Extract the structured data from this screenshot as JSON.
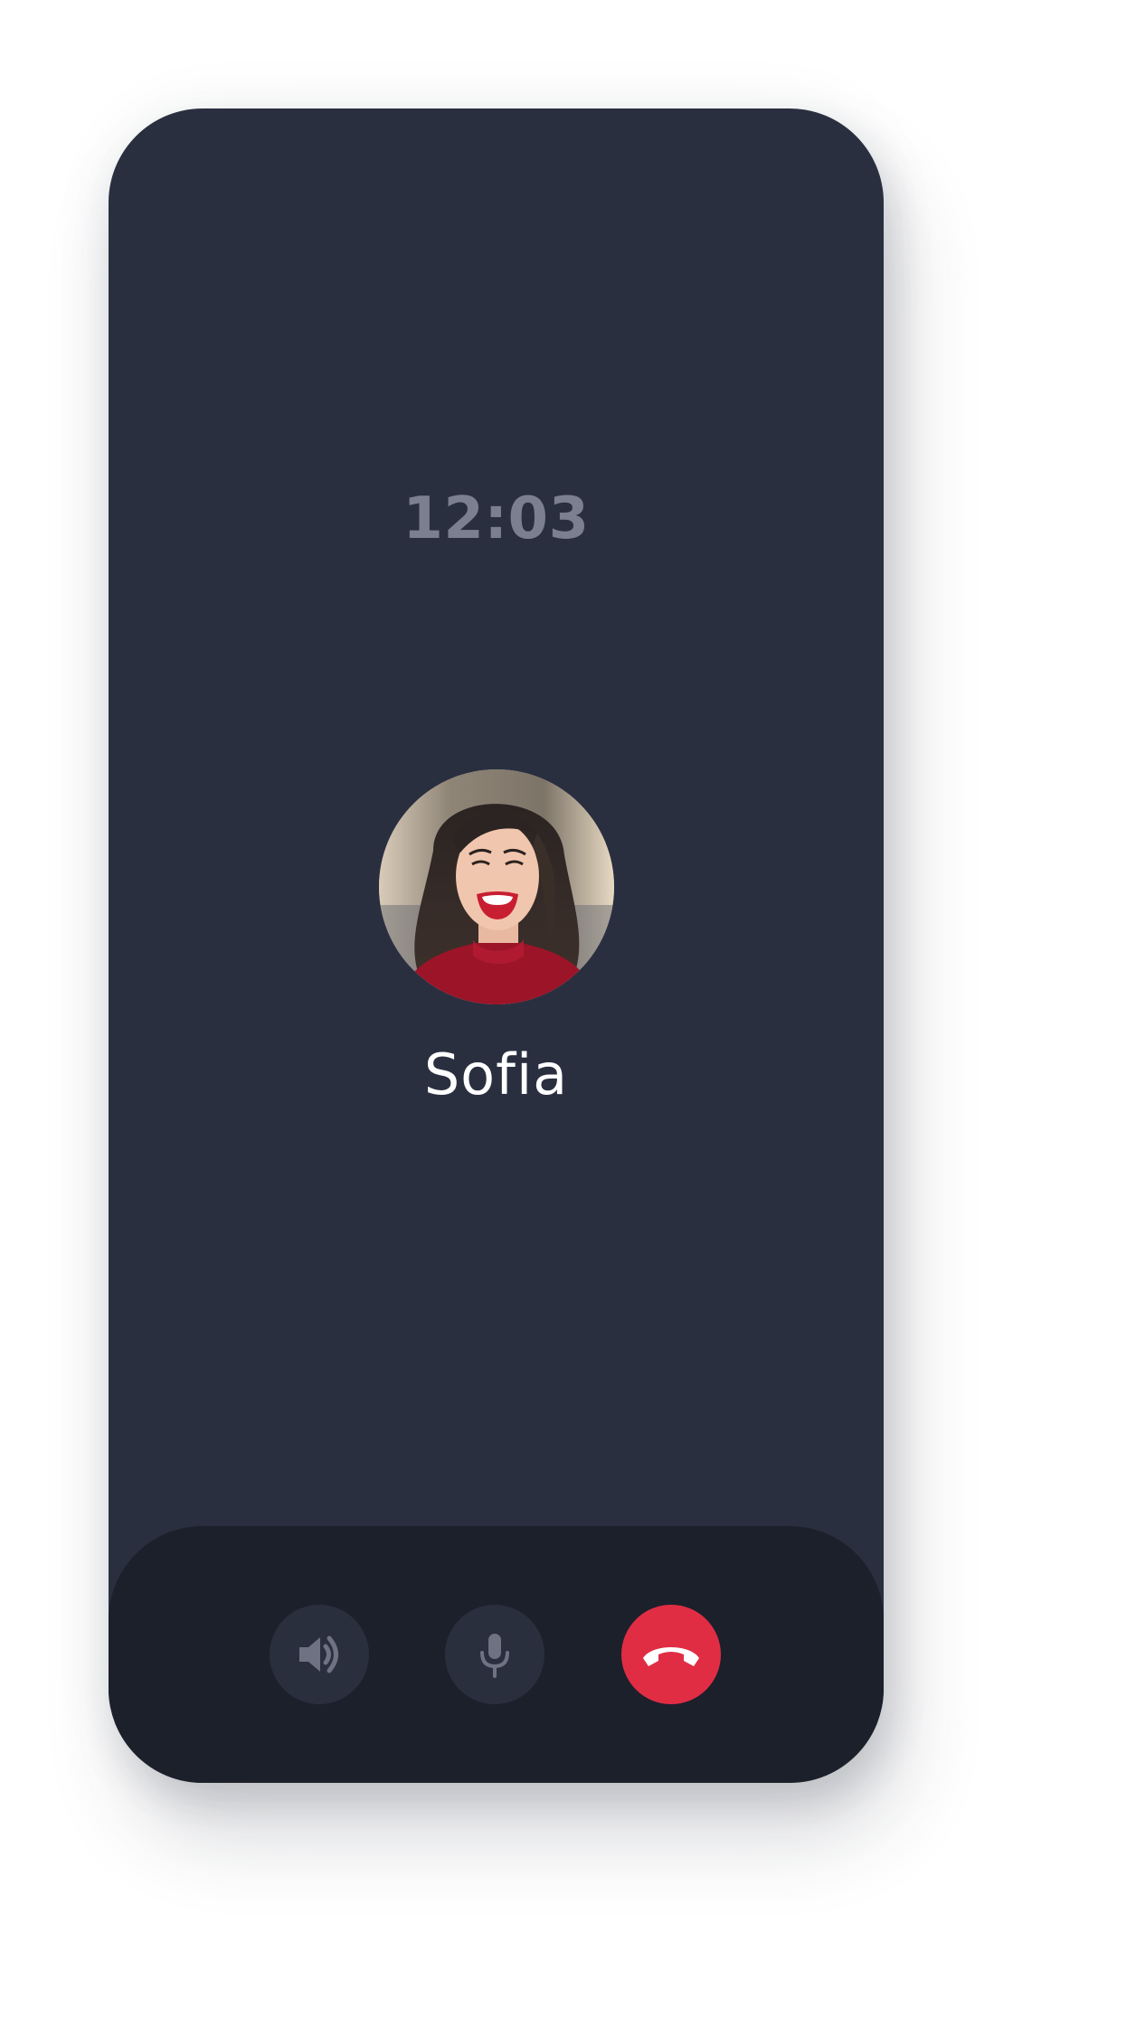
{
  "call": {
    "time": "12:03",
    "caller_name": "Sofia"
  },
  "controls": [
    {
      "id": "speaker",
      "icon": "speaker-icon"
    },
    {
      "id": "mute",
      "icon": "microphone-icon"
    },
    {
      "id": "hangup",
      "icon": "phone-hangup-icon"
    }
  ],
  "colors": {
    "screen_bg": "#2a2f40",
    "control_bar_bg": "#1c202b",
    "control_button_bg": "#2a2f3e",
    "hangup_red": "#e02d44",
    "clock_text": "#7c7f90",
    "name_text": "#ffffff"
  }
}
